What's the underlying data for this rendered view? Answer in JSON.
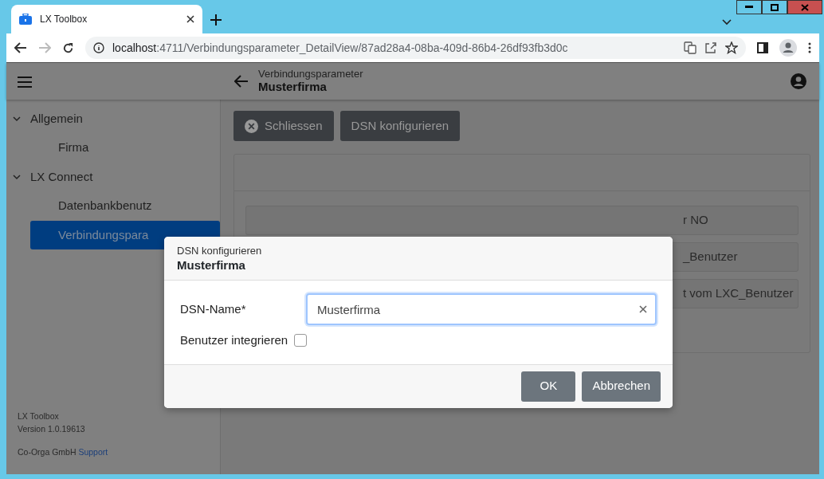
{
  "browser": {
    "tab": {
      "title": "LX Toolbox"
    },
    "address": {
      "host": "localhost",
      "path": ":4711/Verbindungsparameter_DetailView/87ad28a4-08ba-409d-86b4-26df93fb3d0c"
    }
  },
  "app": {
    "header": {
      "subtitle": "Verbindungsparameter",
      "title": "Musterfirma"
    },
    "sidebar": {
      "items": [
        {
          "label": "Allgemein",
          "expanded": true,
          "children": [
            {
              "label": "Firma",
              "selected": false
            }
          ]
        },
        {
          "label": "LX Connect",
          "expanded": true,
          "children": [
            {
              "label": "Datenbankbenutz",
              "selected": false
            },
            {
              "label": "Verbindungspara",
              "selected": true
            }
          ]
        }
      ],
      "footer": {
        "product": "LX Toolbox",
        "version": "Version 1.0.19613",
        "company": "Co-Orga GmbH",
        "link": "Support"
      }
    },
    "toolbar": [
      {
        "kind": "icon",
        "label": "Schliessen"
      },
      {
        "kind": "plain",
        "label": "DSN konfigurieren"
      }
    ],
    "card": {
      "buttons": [
        "r NO",
        "_Benutzer",
        "t vom LXC_Benutzer"
      ]
    }
  },
  "dialog": {
    "subtitle": "DSN konfigurieren",
    "title": "Musterfirma",
    "fields": [
      {
        "kind": "text",
        "label": "DSN-Name*",
        "value": "Musterfirma"
      },
      {
        "kind": "checkbox",
        "label": "Benutzer integrieren",
        "checked": false
      }
    ],
    "buttons": [
      "OK",
      "Abbrechen"
    ]
  }
}
